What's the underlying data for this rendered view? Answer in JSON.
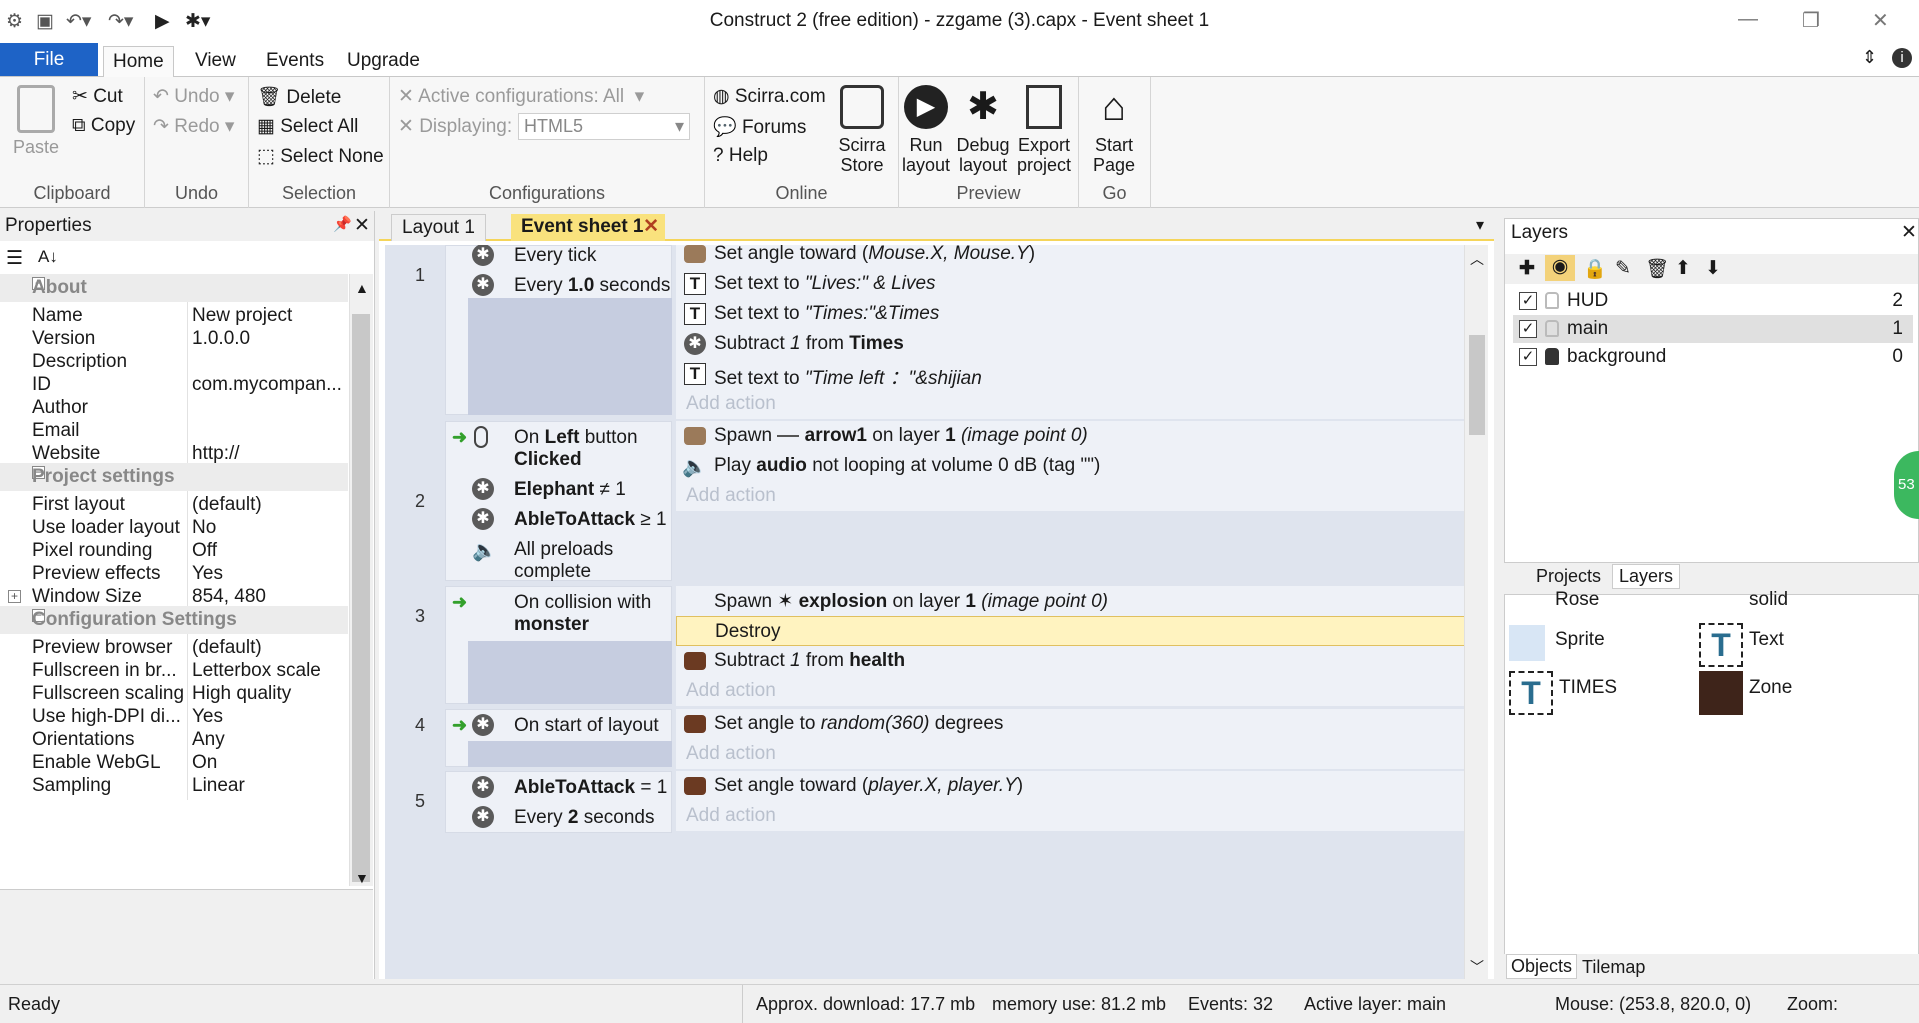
{
  "window": {
    "title": "Construct 2  (free edition) - zzgame (3).capx - Event sheet 1"
  },
  "ribbon_tabs": [
    "File",
    "Home",
    "View",
    "Events",
    "Upgrade"
  ],
  "clipboard": {
    "paste": "Paste",
    "cut": "Cut",
    "copy": "Copy",
    "label": "Clipboard"
  },
  "undo": {
    "undo": "Undo",
    "redo": "Redo",
    "label": "Undo"
  },
  "selection": {
    "delete": "Delete",
    "select_all": "Select All",
    "select_none": "Select None",
    "label": "Selection"
  },
  "configurations": {
    "active_label": "Active configurations: All",
    "displaying_label": "Displaying:",
    "displaying_value": "HTML5",
    "label": "Configurations"
  },
  "online": {
    "scirra": "Scirra.com",
    "forums": "Forums",
    "help": "Help",
    "store": "Scirra Store",
    "label": "Online"
  },
  "preview": {
    "run": "Run layout",
    "debug": "Debug layout",
    "export": "Export project",
    "label": "Preview"
  },
  "go": {
    "start": "Start Page",
    "label": "Go"
  },
  "properties": {
    "title": "Properties",
    "sections": [
      {
        "name": "About",
        "rows": [
          [
            "Name",
            "New project"
          ],
          [
            "Version",
            "1.0.0.0"
          ],
          [
            "Description",
            ""
          ],
          [
            "ID",
            "com.mycompan..."
          ],
          [
            "Author",
            ""
          ],
          [
            "Email",
            ""
          ],
          [
            "Website",
            "http://"
          ]
        ]
      },
      {
        "name": "Project settings",
        "rows": [
          [
            "First layout",
            "(default)"
          ],
          [
            "Use loader layout",
            "No"
          ],
          [
            "Pixel rounding",
            "Off"
          ],
          [
            "Preview effects",
            "Yes"
          ],
          [
            "Window Size",
            "854, 480"
          ]
        ]
      },
      {
        "name": "Configuration Settings",
        "rows": [
          [
            "Preview browser",
            "(default)"
          ],
          [
            "Fullscreen in br...",
            "Letterbox scale"
          ],
          [
            "Fullscreen scaling",
            "High quality"
          ],
          [
            "Use high-DPI di...",
            "Yes"
          ],
          [
            "Orientations",
            "Any"
          ],
          [
            "Enable WebGL",
            "On"
          ],
          [
            "Sampling",
            "Linear"
          ]
        ]
      }
    ]
  },
  "doc_tabs": {
    "layout": "Layout 1",
    "sheet": "Event sheet 1"
  },
  "events": {
    "e1": {
      "num": "1",
      "c1": "Every tick",
      "c2a": "Every ",
      "c2b": "1.0",
      "c2c": " seconds",
      "a1a": "Set angle toward (",
      "a1b": "Mouse.X, Mouse.Y",
      "a1c": ")",
      "a2a": "Set text to ",
      "a2b": "\"Lives:\" & Lives",
      "a3a": "Set text to ",
      "a3b": "\"Times:\"&Times",
      "a4a": "Subtract ",
      "a4b": "1",
      "a4c": " from ",
      "a4d": "Times",
      "a5a": "Set text to ",
      "a5b": "\"Time left ：\"&shijian",
      "add": "Add action"
    },
    "e2": {
      "num": "2",
      "c1a": "On ",
      "c1b": "Left",
      "c1c": " button",
      "c1d": "Clicked",
      "c2a": "Elephant",
      "c2b": " ≠ 1",
      "c3a": "AbleToAttack",
      "c3b": " ≥ 1",
      "c4a": "All preloads",
      "c4b": "complete",
      "a1a": "Spawn ",
      "a1b": "arrow1",
      "a1c": " on layer ",
      "a1d": "1",
      "a1e": " (image point 0)",
      "a2a": "Play ",
      "a2b": "audio",
      "a2c": " not looping at volume 0 dB (tag \"\")",
      "add": "Add action"
    },
    "e3": {
      "num": "3",
      "c1a": "On collision with",
      "c1b": "monster",
      "a1a": "Spawn ",
      "a1b": "explosion",
      "a1c": " on layer ",
      "a1d": "1",
      "a1e": " (image point 0)",
      "a2": "Destroy",
      "a3a": "Subtract ",
      "a3b": "1",
      "a3c": " from ",
      "a3d": "health",
      "add": "Add action"
    },
    "e4": {
      "num": "4",
      "c1": "On start of layout",
      "a1a": "Set angle to ",
      "a1b": "random(360)",
      "a1c": " degrees",
      "add": "Add action"
    },
    "e5": {
      "num": "5",
      "c1a": "AbleToAttack",
      "c1b": " = 1",
      "c2a": "Every ",
      "c2b": "2",
      "c2c": " seconds",
      "a1a": "Set angle toward (",
      "a1b": "player.X, player.Y",
      "a1c": ")",
      "add": "Add action"
    }
  },
  "layers": {
    "title": "Layers",
    "rows": [
      [
        "HUD",
        "2"
      ],
      [
        "main",
        "1"
      ],
      [
        "background",
        "0"
      ]
    ],
    "tabs": [
      "Projects",
      "Layers"
    ]
  },
  "objects": {
    "items": [
      "Rose",
      "solid",
      "Sprite",
      "Text",
      "TIMES",
      "Zone"
    ],
    "tabs": [
      "Objects",
      "Tilemap"
    ]
  },
  "status": {
    "ready": "Ready",
    "download": "Approx. download: 17.7 mb",
    "memory": "memory use: 81.2 mb",
    "events": "Events: 32",
    "layer": "Active layer: main",
    "mouse": "Mouse: (253.8, 820.0, 0)",
    "zoom": "Zoom:"
  },
  "badge": "53"
}
